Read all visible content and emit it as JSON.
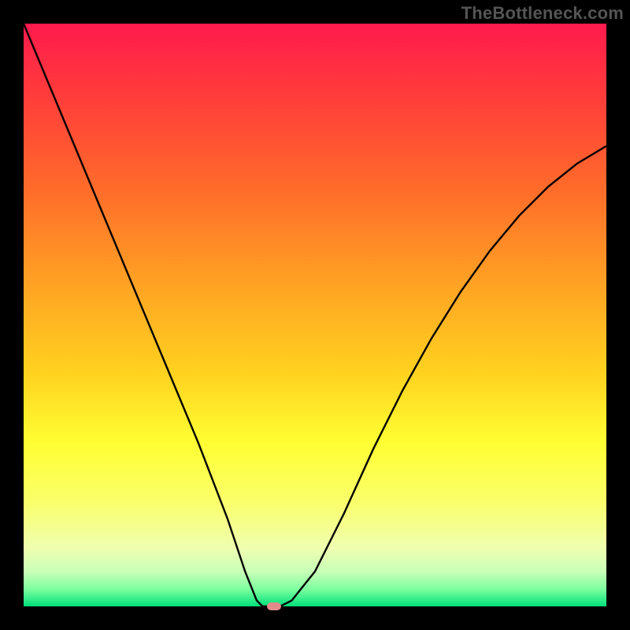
{
  "watermark": "TheBottleneck.com",
  "colors": {
    "frame": "#000000",
    "curve": "#000000",
    "marker": "#e28b8b",
    "gradient_top": "#ff1a4d",
    "gradient_bottom": "#00e07a"
  },
  "chart_data": {
    "type": "line",
    "title": "",
    "xlabel": "",
    "ylabel": "",
    "xlim": [
      0,
      100
    ],
    "ylim": [
      0,
      100
    ],
    "grid": false,
    "legend": false,
    "annotations": [
      "TheBottleneck.com"
    ],
    "series": [
      {
        "name": "bottleneck-curve",
        "x": [
          0,
          5,
          10,
          15,
          20,
          25,
          30,
          35,
          38,
          40,
          41,
          42,
          43,
          44,
          46,
          50,
          55,
          60,
          65,
          70,
          75,
          80,
          85,
          90,
          95,
          100
        ],
        "y": [
          100,
          88,
          76,
          64,
          52,
          40,
          28,
          15,
          6,
          1,
          0,
          0,
          0,
          0,
          1,
          6,
          16,
          27,
          37,
          46,
          54,
          61,
          67,
          72,
          76,
          79
        ]
      }
    ],
    "marker": {
      "x": 43,
      "y": 0
    }
  }
}
